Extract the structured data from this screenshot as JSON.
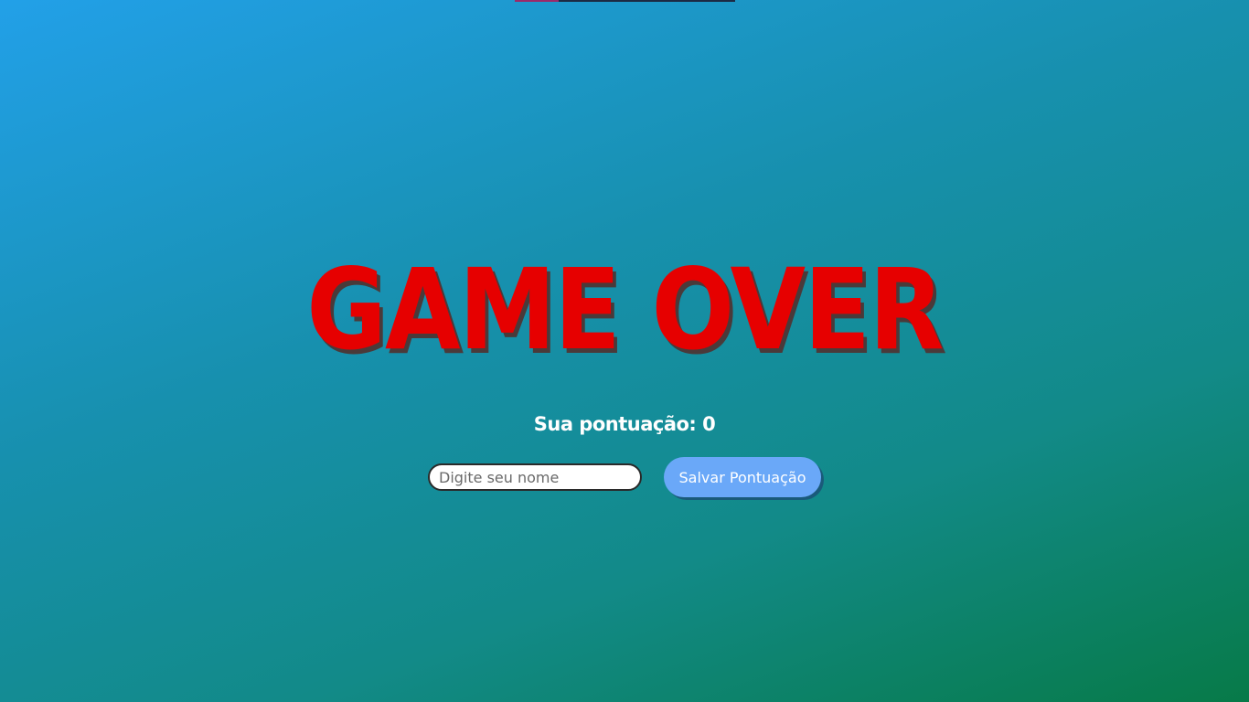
{
  "game_over": {
    "title": "GAME OVER",
    "score_label": "Sua pontuação: 0",
    "name_input": {
      "value": "",
      "placeholder": "Digite seu nome"
    },
    "save_button_label": "Salvar Pontuação"
  },
  "colors": {
    "title": "#e60000",
    "title_shadow": "#4a3a3a",
    "button_bg": "#6aa8f8",
    "background_start": "#22a0e8",
    "background_end": "#077a48"
  }
}
